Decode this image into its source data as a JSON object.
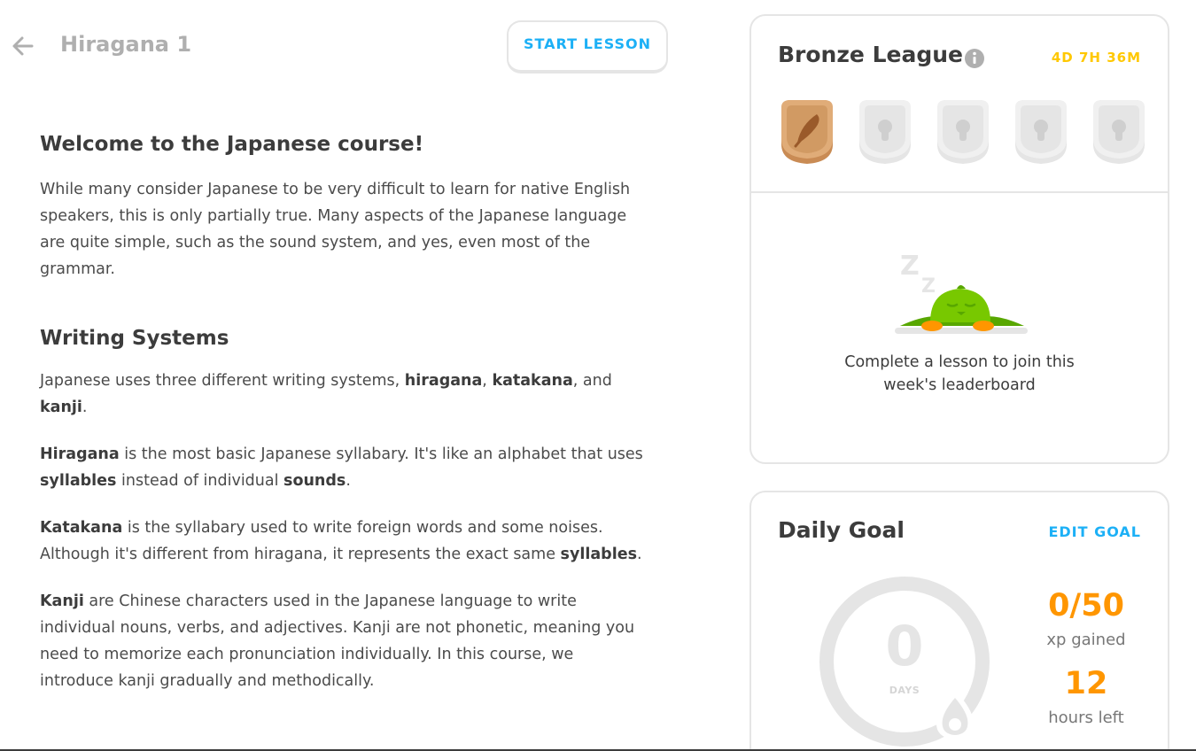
{
  "header": {
    "title": "Hiragana 1",
    "start_lesson_label": "START LESSON"
  },
  "article": {
    "welcome_heading": "Welcome to the Japanese course!",
    "intro": "While many consider Japanese to be very difficult to learn for native English speakers, this is only partially true. Many aspects of the Japanese language are quite simple, such as the sound system, and yes, even most of the grammar.",
    "writing_heading": "Writing Systems",
    "writing_systems": {
      "lead": "Japanese uses three different writing systems, ",
      "term1": "hiragana",
      "sep1": ", ",
      "term2": "katakana",
      "sep2": ", and ",
      "term3": "kanji",
      "end": "."
    },
    "hiragana": {
      "term": "Hiragana",
      "text1": " is the most basic Japanese syllabary. It's like an alphabet that uses ",
      "term2": "syllables",
      "text2": " instead of individual ",
      "term3": "sounds",
      "end": "."
    },
    "katakana": {
      "term": "Katakana",
      "text1": " is the syllabary used to write foreign words and some noises. Although it's different from hiragana, it represents the exact same ",
      "term2": "syllables",
      "end": "."
    },
    "kanji": {
      "term": "Kanji",
      "text1": " are Chinese characters used in the Japanese language to write individual nouns, verbs, and adjectives. Kanji are not phonetic, meaning you need to memorize each pronunciation individually. In this course, we introduce kanji gradually and methodically."
    }
  },
  "league": {
    "title": "Bronze League",
    "timer": "4D 7H 36M",
    "badges": [
      "bronze-league-icon",
      "locked-league-icon",
      "locked-league-icon",
      "locked-league-icon",
      "locked-league-icon"
    ],
    "join_text_line1": "Complete a lesson to join this",
    "join_text_line2": "week's leaderboard"
  },
  "daily_goal": {
    "title": "Daily Goal",
    "edit_label": "EDIT GOAL",
    "streak_value": "0",
    "streak_label": "DAYS",
    "xp_value": "0/50",
    "xp_label": "xp gained",
    "hours_value": "12",
    "hours_label": "hours left"
  },
  "colors": {
    "accent_blue": "#1cb0f6",
    "timer_yellow": "#ffc800",
    "stat_orange": "#ff9600",
    "bronze": "#d19a63",
    "owl_green": "#78c800"
  }
}
